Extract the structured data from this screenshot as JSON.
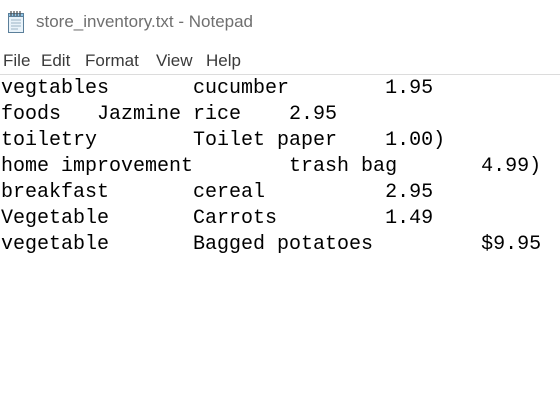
{
  "window": {
    "title": "store_inventory.txt - Notepad",
    "icon": "notepad-icon"
  },
  "menubar": {
    "items": [
      "File",
      "Edit",
      "Format",
      "View",
      "Help"
    ]
  },
  "editor": {
    "lines": [
      "vegtables       cucumber        1.95",
      "foods   Jazmine rice    2.95",
      "toiletry        Toilet paper    1.00)",
      "home improvement        trash bag       4.99)",
      "breakfast       cereal          2.95",
      "Vegetable       Carrots         1.49",
      "vegetable       Bagged potatoes         $9.95"
    ]
  }
}
